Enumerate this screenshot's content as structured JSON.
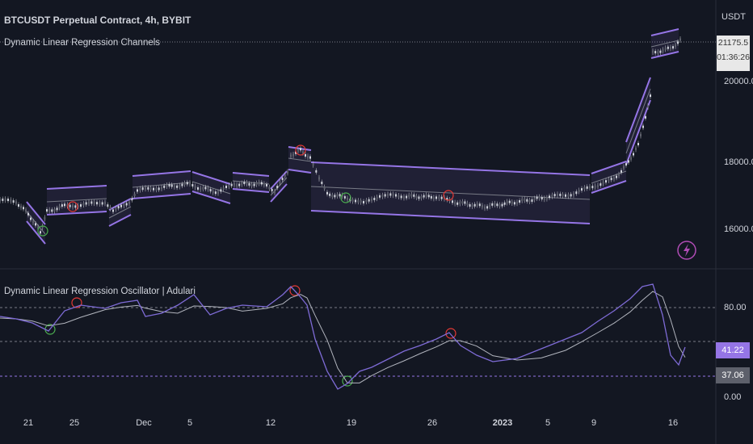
{
  "legend": {
    "symbol_title": "BTCUSDT Perpetual Contract, 4h, BYBIT",
    "main_indicator": "Dynamic Linear Regression Channels",
    "sub_indicator": "Dynamic Linear Regression Oscillator | Adulari"
  },
  "price_axis": {
    "currency": "USDT",
    "ticks": [
      "20000.0",
      "18000.0",
      "16000.0"
    ],
    "last_price": "21175.5",
    "countdown": "01:36:26"
  },
  "osc_axis": {
    "ticks": [
      "80.00",
      "0.00"
    ],
    "value_tag": "41.22",
    "signal_tag": "37.06"
  },
  "time_axis": {
    "ticks": [
      "21",
      "25",
      "Dec",
      "5",
      "12",
      "19",
      "26",
      "2023",
      "5",
      "9",
      "16"
    ]
  },
  "colors": {
    "background": "#131722",
    "channel": "#9575e6",
    "osc_line": "#7e6bd6",
    "signal_line": "#b2b5be",
    "bull_marker": "#4caf50",
    "bear_marker": "#e53935"
  },
  "icons": {
    "replay": "lightning-bolt-icon"
  }
}
